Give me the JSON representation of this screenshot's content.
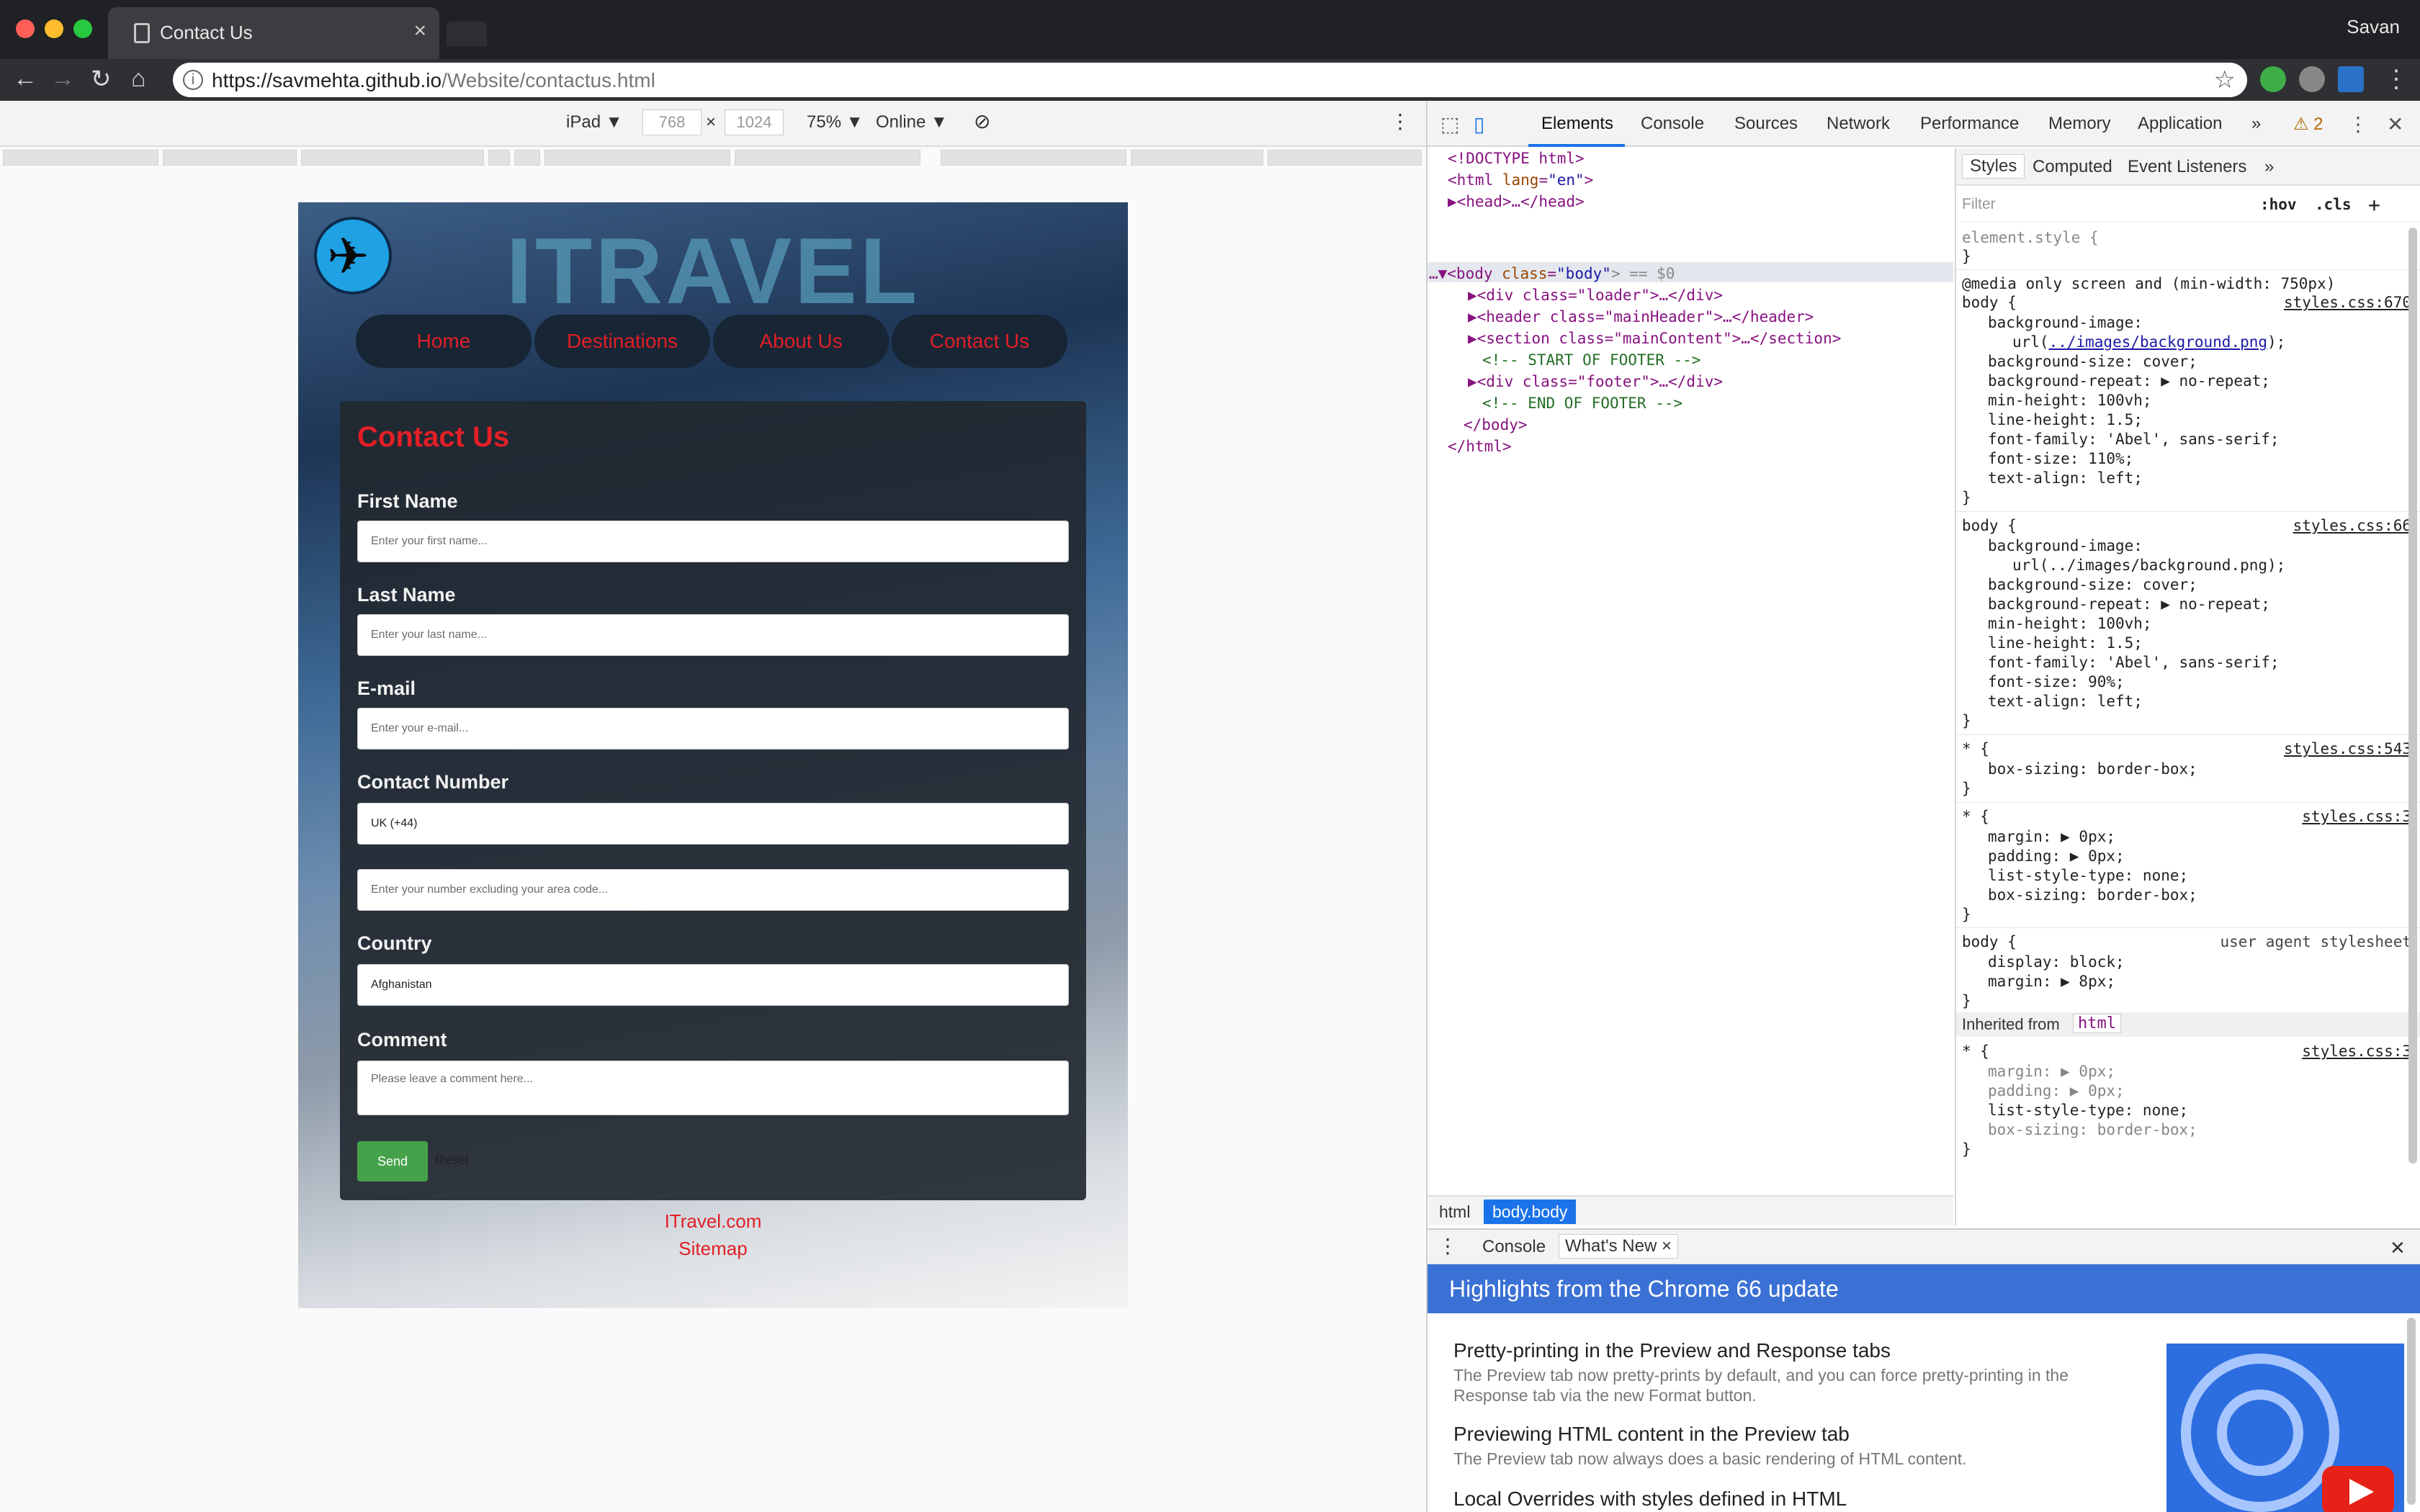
{
  "browser": {
    "tab_title": "Contact Us",
    "tab_close": "×",
    "profile": "Savan",
    "url_host": "https://savmehta.github.io",
    "url_path": "/Website/contactus.html"
  },
  "device_toolbar": {
    "device": "iPad ▼",
    "width": "768",
    "times": "×",
    "height": "1024",
    "zoom": "75% ▼",
    "network": "Online ▼"
  },
  "site": {
    "brand": "ITRAVEL",
    "nav": [
      "Home",
      "Destinations",
      "About Us",
      "Contact Us"
    ],
    "form_title": "Contact Us",
    "fields": {
      "first_name_label": "First Name",
      "first_name_placeholder": "Enter your first name...",
      "last_name_label": "Last Name",
      "last_name_placeholder": "Enter your last name...",
      "email_label": "E-mail",
      "email_placeholder": "Enter your e-mail...",
      "contact_label": "Contact Number",
      "contact_code": "UK (+44)",
      "contact_placeholder": "Enter your number excluding your area code...",
      "country_label": "Country",
      "country_value": "Afghanistan",
      "comment_label": "Comment",
      "comment_placeholder": "Please leave a comment here..."
    },
    "send_label": "Send",
    "reset_label": "Reset",
    "footer_site": "ITravel.com",
    "footer_sitemap": "Sitemap"
  },
  "devtools": {
    "tabs": [
      "Elements",
      "Console",
      "Sources",
      "Network",
      "Performance",
      "Memory",
      "Application"
    ],
    "more": "»",
    "warnings": "⚠ 2",
    "dom": {
      "doctype": "<!DOCTYPE html>",
      "html_open": "<html ",
      "lang_attr": "lang",
      "lang_val": "\"en\"",
      "head": "▶<head>…</head>",
      "body_prefix": "…▼<body ",
      "body_class_attr": "class",
      "body_class_val": "\"body\"",
      "body_suffix": "> == $0",
      "div_loader": "▶<div class=\"loader\">…</div>",
      "header_main": "▶<header class=\"mainHeader\">…</header>",
      "section_main": "▶<section class=\"mainContent\">…</section>",
      "cmt_start": "<!-- START OF FOOTER -->",
      "div_footer": "▶<div class=\"footer\">…</div>",
      "cmt_end": "<!-- END OF FOOTER -->",
      "body_close": "</body>",
      "html_close": "</html>"
    },
    "breadcrumbs": [
      "html",
      "body.body"
    ],
    "styles_tabs": [
      "Styles",
      "Computed",
      "Event Listeners",
      "»"
    ],
    "filter_placeholder": "Filter",
    "hov": ":hov",
    "cls": ".cls",
    "plus": "+",
    "rules": {
      "element_style": "element.style {",
      "close": "}",
      "media": "@media only screen and (min-width: 750px)",
      "body_sel": "body {",
      "src_670": "styles.css:670",
      "src_66": "styles.css:66",
      "src_543": "styles.css:543",
      "src_3": "styles.css:3",
      "user_agent": "user agent stylesheet",
      "star_sel": "* {",
      "inherited_from": "Inherited from",
      "inherited_tag": "html",
      "r1": [
        "background-image:",
        "url(",
        "../images/background.png",
        ");",
        "background-size: cover;",
        "background-repeat: ▶ no-repeat;",
        "min-height: 100vh;",
        "line-height: 1.5;",
        "font-family: 'Abel', sans-serif;",
        "font-size: 110%;",
        "text-align: left;"
      ],
      "r2": [
        "background-image:",
        "url(../images/background.png);",
        "background-size: cover;",
        "background-repeat: ▶ no-repeat;",
        "min-height: 100vh;",
        "line-height: 1.5;",
        "font-family: 'Abel', sans-serif;",
        "font-size: 90%;",
        "text-align: left;"
      ],
      "r3": [
        "box-sizing: border-box;"
      ],
      "r4": [
        "margin: ▶ 0px;",
        "padding: ▶ 0px;",
        "list-style-type: none;",
        "box-sizing: border-box;"
      ],
      "r5": [
        "display: block;",
        "margin: ▶ 8px;"
      ],
      "r6": [
        "margin: ▶ 0px;",
        "padding: ▶ 0px;",
        "list-style-type: none;",
        "box-sizing: border-box;"
      ]
    },
    "drawer_tabs": [
      "Console",
      "What's New ×"
    ],
    "whatsnew_title": "Highlights from the Chrome 66 update",
    "items": [
      {
        "title": "Pretty-printing in the Preview and Response tabs",
        "desc": "The Preview tab now pretty-prints by default, and you can force pretty-printing in the Response tab via the new Format button."
      },
      {
        "title": "Previewing HTML content in the Preview tab",
        "desc": "The Preview tab now always does a basic rendering of HTML content."
      },
      {
        "title": "Local Overrides with styles defined in HTML",
        "desc": ""
      }
    ]
  }
}
